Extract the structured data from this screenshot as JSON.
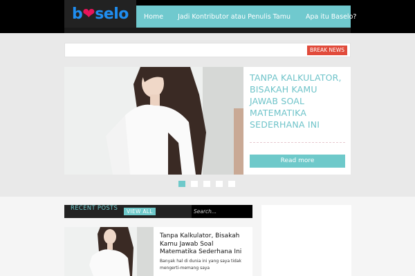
{
  "site": {
    "logo_text_start": "b",
    "logo_text_end": "selo",
    "colors": {
      "accent": "#6ec9ca",
      "logo_blue": "#1f8ef1",
      "logo_heart": "#e8145a",
      "break_red": "#e14b3b"
    }
  },
  "nav": {
    "items": [
      {
        "label": "Home"
      },
      {
        "label": "Jadi Kontributor atau Penulis Tamu"
      },
      {
        "label": "Apa itu Baselo?"
      }
    ]
  },
  "breaking": {
    "label": "BREAK NEWS"
  },
  "slider": {
    "title": "Tanpa Kalkulator, Bisakah Kamu Jawab Soal Matematika Sederhana Ini",
    "read_more": "Read more",
    "image_icon": "woman-photo",
    "dots": 5,
    "active_dot": 1
  },
  "recent": {
    "label": "RECENT POSTS",
    "view_all": "VIEW ALL",
    "search_placeholder": "Search...",
    "posts": [
      {
        "title": "Tanpa Kalkulator, Bisakah Kamu Jawab Soal Matematika Sederhana Ini",
        "excerpt": "Banyak hal di dunia ini yang saya tidak mengerti-memang saya"
      }
    ]
  }
}
